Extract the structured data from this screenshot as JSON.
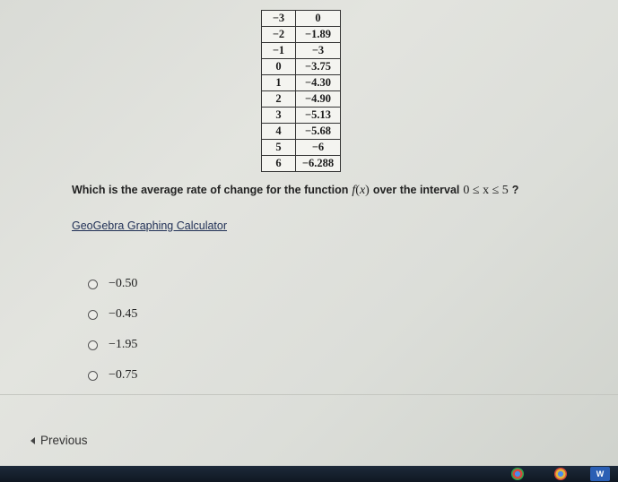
{
  "table": {
    "header": {
      "x": "−3",
      "y": "0"
    },
    "rows": [
      {
        "x": "−2",
        "y": "−1.89"
      },
      {
        "x": "−1",
        "y": "−3"
      },
      {
        "x": "0",
        "y": "−3.75"
      },
      {
        "x": "1",
        "y": "−4.30"
      },
      {
        "x": "2",
        "y": "−4.90"
      },
      {
        "x": "3",
        "y": "−5.13"
      },
      {
        "x": "4",
        "y": "−5.68"
      },
      {
        "x": "5",
        "y": "−6"
      },
      {
        "x": "6",
        "y": "−6.288"
      }
    ]
  },
  "question": {
    "text_before": "Which is the average rate of change for the function",
    "function_name": "f",
    "function_var": "x",
    "text_middle": "over the interval",
    "interval": "0 ≤ x ≤ 5",
    "text_after": "?"
  },
  "calculator_link": "GeoGebra Graphing Calculator",
  "choices": [
    "−0.50",
    "−0.45",
    "−1.95",
    "−0.75"
  ],
  "nav": {
    "previous_label": "Previous"
  },
  "taskbar": {
    "word_label": "W"
  }
}
